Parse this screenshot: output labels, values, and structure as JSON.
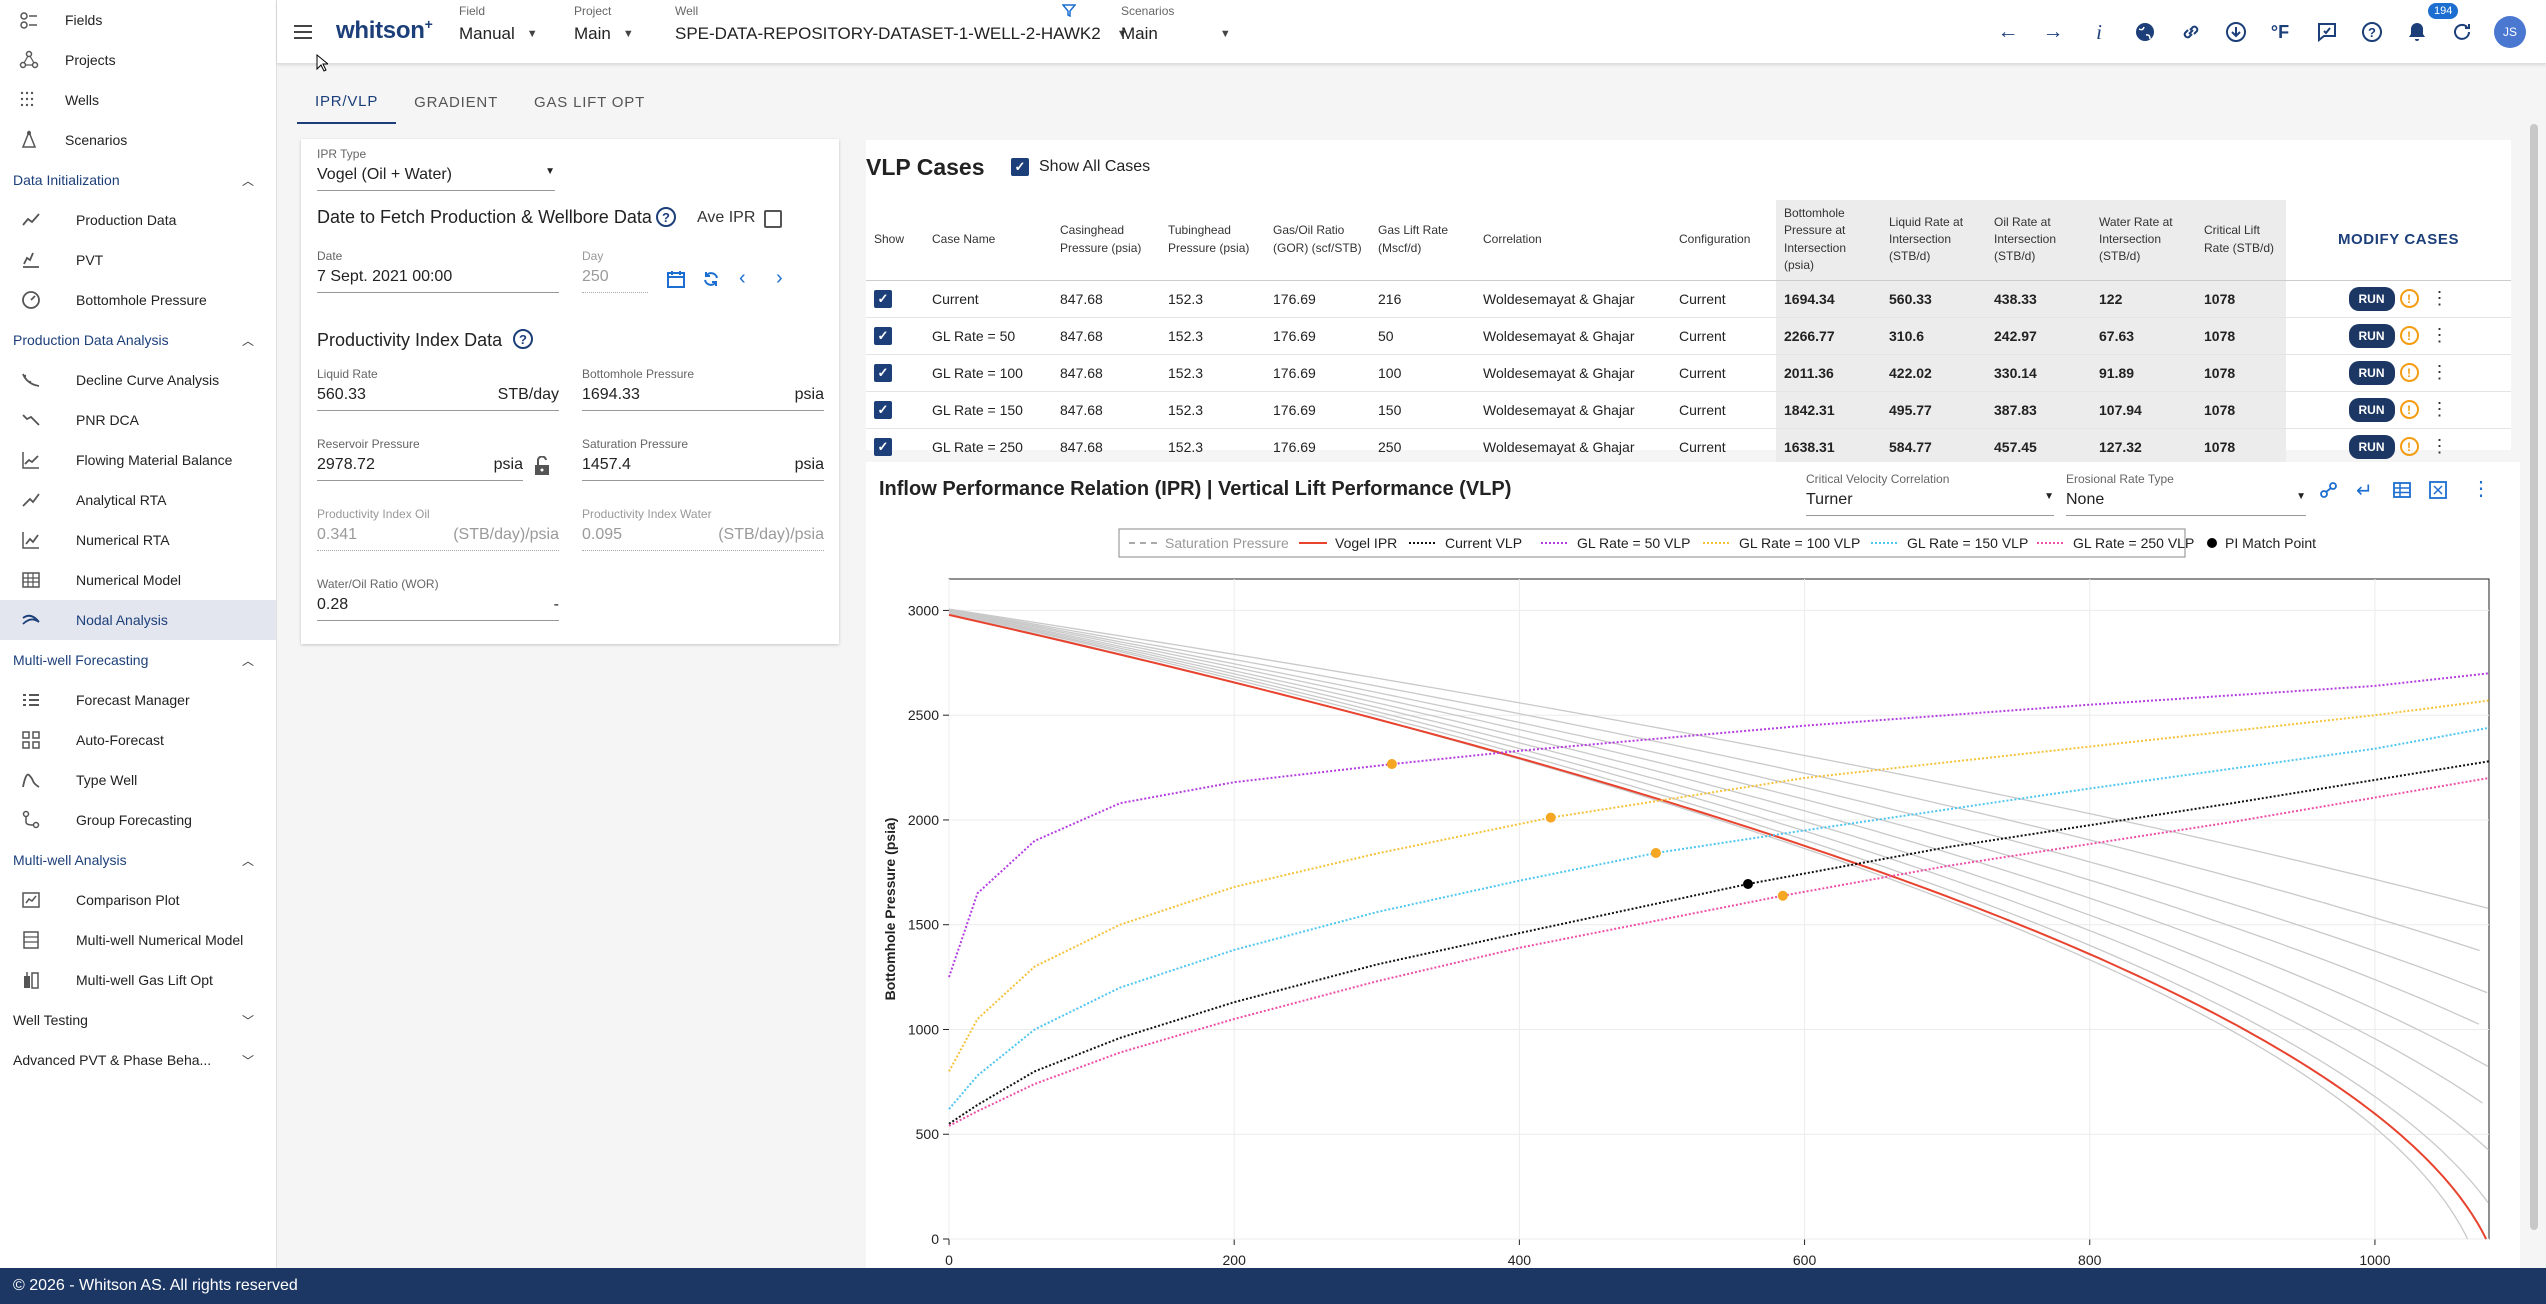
{
  "sidebar": {
    "top_items": [
      {
        "label": "Fields",
        "icon": "fields-icon"
      },
      {
        "label": "Projects",
        "icon": "projects-icon"
      },
      {
        "label": "Wells",
        "icon": "wells-icon"
      },
      {
        "label": "Scenarios",
        "icon": "scenarios-icon"
      }
    ],
    "sections": [
      {
        "label": "Data Initialization",
        "open": true,
        "items": [
          {
            "label": "Production Data",
            "icon": "production-data-icon"
          },
          {
            "label": "PVT",
            "icon": "pvt-icon"
          },
          {
            "label": "Bottomhole Pressure",
            "icon": "bottomhole-pressure-icon"
          }
        ]
      },
      {
        "label": "Production Data Analysis",
        "open": true,
        "items": [
          {
            "label": "Decline Curve Analysis",
            "icon": "decline-curve-icon"
          },
          {
            "label": "PNR DCA",
            "icon": "pnr-dca-icon"
          },
          {
            "label": "Flowing Material Balance",
            "icon": "flowing-material-balance-icon"
          },
          {
            "label": "Analytical RTA",
            "icon": "analytical-rta-icon"
          },
          {
            "label": "Numerical RTA",
            "icon": "numerical-rta-icon"
          },
          {
            "label": "Numerical Model",
            "icon": "numerical-model-icon"
          },
          {
            "label": "Nodal Analysis",
            "icon": "nodal-analysis-icon",
            "active": true
          }
        ]
      },
      {
        "label": "Multi-well Forecasting",
        "open": true,
        "items": [
          {
            "label": "Forecast Manager",
            "icon": "forecast-manager-icon"
          },
          {
            "label": "Auto-Forecast",
            "icon": "auto-forecast-icon"
          },
          {
            "label": "Type Well",
            "icon": "type-well-icon"
          },
          {
            "label": "Group Forecasting",
            "icon": "group-forecasting-icon"
          }
        ]
      },
      {
        "label": "Multi-well Analysis",
        "open": true,
        "items": [
          {
            "label": "Comparison Plot",
            "icon": "comparison-plot-icon"
          },
          {
            "label": "Multi-well Numerical Model",
            "icon": "multiwell-numerical-model-icon"
          },
          {
            "label": "Multi-well Gas Lift Opt",
            "icon": "multiwell-gas-lift-icon"
          }
        ]
      },
      {
        "label": "Well Testing",
        "open": false,
        "items": []
      },
      {
        "label": "Advanced PVT & Phase Beha...",
        "open": false,
        "items": []
      }
    ]
  },
  "topbar": {
    "logo": "whitson",
    "logo_sup": "+",
    "field": {
      "caption": "Field",
      "value": "Manual"
    },
    "project": {
      "caption": "Project",
      "value": "Main"
    },
    "well": {
      "caption": "Well",
      "value": "SPE-DATA-REPOSITORY-DATASET-1-WELL-2-HAWK2"
    },
    "scenarios": {
      "caption": "Scenarios",
      "value": "Main"
    },
    "notification_count": "194",
    "units_label": "°F",
    "avatar_initials": "JS"
  },
  "tabs": [
    "IPR/VLP",
    "GRADIENT",
    "GAS LIFT OPT"
  ],
  "ipr": {
    "type_caption": "IPR Type",
    "type_value": "Vogel (Oil + Water)",
    "date_section_title": "Date to Fetch Production & Wellbore Data",
    "ave_ipr_label": "Ave IPR",
    "date_caption": "Date",
    "date_value": "7 Sept. 2021 00:00",
    "day_caption": "Day",
    "day_value": "250",
    "pi_section_title": "Productivity Index Data",
    "liquid_rate": {
      "caption": "Liquid Rate",
      "value": "560.33",
      "unit": "STB/day"
    },
    "bhp": {
      "caption": "Bottomhole Pressure",
      "value": "1694.33",
      "unit": "psia"
    },
    "reservoir_pressure": {
      "caption": "Reservoir Pressure",
      "value": "2978.72",
      "unit": "psia"
    },
    "saturation_pressure": {
      "caption": "Saturation Pressure",
      "value": "1457.4",
      "unit": "psia"
    },
    "pi_oil": {
      "caption": "Productivity Index Oil",
      "value": "0.341",
      "unit": "(STB/day)/psia"
    },
    "pi_water": {
      "caption": "Productivity Index Water",
      "value": "0.095",
      "unit": "(STB/day)/psia"
    },
    "wor": {
      "caption": "Water/Oil Ratio (WOR)",
      "value": "0.28",
      "unit": "-"
    }
  },
  "vlp": {
    "title": "VLP Cases",
    "show_all_label": "Show All Cases",
    "modify_label": "MODIFY CASES",
    "run_label": "RUN",
    "columns": [
      "Show",
      "Case Name",
      "Casinghead Pressure (psia)",
      "Tubinghead Pressure (psia)",
      "Gas/Oil Ratio (GOR) (scf/STB)",
      "Gas Lift Rate (Mscf/d)",
      "Correlation",
      "Configuration",
      "Bottomhole Pressure at Intersection (psia)",
      "Liquid Rate at Intersection (STB/d)",
      "Oil Rate at Intersection (STB/d)",
      "Water Rate at Intersection (STB/d)",
      "Critical Lift Rate (STB/d)"
    ],
    "rows": [
      [
        "Current",
        "847.68",
        "152.3",
        "176.69",
        "216",
        "Woldesemayat & Ghajar",
        "Current",
        "1694.34",
        "560.33",
        "438.33",
        "122",
        "1078"
      ],
      [
        "GL Rate = 50",
        "847.68",
        "152.3",
        "176.69",
        "50",
        "Woldesemayat & Ghajar",
        "Current",
        "2266.77",
        "310.6",
        "242.97",
        "67.63",
        "1078"
      ],
      [
        "GL Rate = 100",
        "847.68",
        "152.3",
        "176.69",
        "100",
        "Woldesemayat & Ghajar",
        "Current",
        "2011.36",
        "422.02",
        "330.14",
        "91.89",
        "1078"
      ],
      [
        "GL Rate = 150",
        "847.68",
        "152.3",
        "176.69",
        "150",
        "Woldesemayat & Ghajar",
        "Current",
        "1842.31",
        "495.77",
        "387.83",
        "107.94",
        "1078"
      ],
      [
        "GL Rate = 250",
        "847.68",
        "152.3",
        "176.69",
        "250",
        "Woldesemayat & Ghajar",
        "Current",
        "1638.31",
        "584.77",
        "457.45",
        "127.32",
        "1078"
      ]
    ]
  },
  "chart_panel": {
    "title": "Inflow Performance Relation (IPR) | Vertical Lift Performance (VLP)",
    "critical_velocity": {
      "caption": "Critical Velocity Correlation",
      "value": "Turner"
    },
    "erosional_rate": {
      "caption": "Erosional Rate Type",
      "value": "None"
    }
  },
  "chart_data": {
    "type": "line",
    "ylabel": "Bottomhole Pressure (psia)",
    "xlabel": "",
    "xlim": [
      0,
      1080
    ],
    "ylim": [
      0,
      3150
    ],
    "xticks": [
      0,
      200,
      400,
      600,
      800,
      1000
    ],
    "yticks": [
      0,
      500,
      1000,
      1500,
      2000,
      2500,
      3000
    ],
    "grid": true,
    "legend_position": "top",
    "legend": [
      {
        "name": "Saturation Pressure",
        "color": "#aaaaaa",
        "style": "dash"
      },
      {
        "name": "Vogel IPR",
        "color": "#e8432e",
        "style": "solid"
      },
      {
        "name": "Current VLP",
        "color": "#111111",
        "style": "dot"
      },
      {
        "name": "GL Rate = 50 VLP",
        "color": "#b43de0",
        "style": "dot"
      },
      {
        "name": "GL Rate = 100 VLP",
        "color": "#f5c23b",
        "style": "dot"
      },
      {
        "name": "GL Rate = 150 VLP",
        "color": "#4fc6ef",
        "style": "dot"
      },
      {
        "name": "GL Rate = 250 VLP",
        "color": "#ec4fa8",
        "style": "dot"
      },
      {
        "name": "PI Match Point",
        "color": "#000000",
        "style": "marker"
      }
    ],
    "ipr": {
      "pr": 2978.72,
      "qmax": 1078,
      "color": "#e8432e"
    },
    "historical_ipr": {
      "color": "#c9c9c9",
      "curves": [
        {
          "pr": 2985,
          "qmax": 1065
        },
        {
          "pr": 2990,
          "qmax": 1095
        },
        {
          "pr": 2992,
          "qmax": 1130
        },
        {
          "pr": 2995,
          "qmax": 1170
        },
        {
          "pr": 2997,
          "qmax": 1220
        },
        {
          "pr": 3000,
          "qmax": 1280
        },
        {
          "pr": 3002,
          "qmax": 1350
        },
        {
          "pr": 3004,
          "qmax": 1450
        },
        {
          "pr": 3006,
          "qmax": 1600
        }
      ]
    },
    "series": [
      {
        "name": "GL Rate = 50 VLP",
        "color": "#b43de0",
        "x": [
          0,
          20,
          60,
          120,
          200,
          310.6,
          400,
          600,
          800,
          1000,
          1080
        ],
        "y": [
          1250,
          1650,
          1900,
          2080,
          2180,
          2266.77,
          2330,
          2450,
          2550,
          2640,
          2700
        ]
      },
      {
        "name": "GL Rate = 100 VLP",
        "color": "#f5c23b",
        "x": [
          0,
          20,
          60,
          120,
          200,
          300,
          422.02,
          600,
          800,
          1000,
          1080
        ],
        "y": [
          800,
          1050,
          1300,
          1500,
          1680,
          1840,
          2011.36,
          2200,
          2350,
          2500,
          2570
        ]
      },
      {
        "name": "GL Rate = 150 VLP",
        "color": "#4fc6ef",
        "x": [
          0,
          20,
          60,
          120,
          200,
          300,
          400,
          495.77,
          600,
          800,
          1000,
          1080
        ],
        "y": [
          620,
          780,
          1000,
          1200,
          1380,
          1560,
          1710,
          1842.31,
          1950,
          2150,
          2340,
          2440
        ]
      },
      {
        "name": "Current VLP",
        "color": "#111111",
        "x": [
          0,
          20,
          60,
          120,
          200,
          300,
          400,
          560.33,
          700,
          900,
          1080
        ],
        "y": [
          550,
          640,
          800,
          960,
          1130,
          1310,
          1460,
          1694.34,
          1870,
          2080,
          2280
        ]
      },
      {
        "name": "GL Rate = 250 VLP",
        "color": "#ec4fa8",
        "x": [
          0,
          20,
          60,
          120,
          200,
          300,
          400,
          584.77,
          700,
          900,
          1080
        ],
        "y": [
          540,
          610,
          740,
          890,
          1050,
          1230,
          1390,
          1638.31,
          1780,
          1990,
          2200
        ]
      }
    ],
    "points": [
      {
        "name": "GL Rate = 50",
        "x": 310.6,
        "y": 2266.77,
        "color": "#f5a623"
      },
      {
        "name": "GL Rate = 100",
        "x": 422.02,
        "y": 2011.36,
        "color": "#f5a623"
      },
      {
        "name": "GL Rate = 150",
        "x": 495.77,
        "y": 1842.31,
        "color": "#f5a623"
      },
      {
        "name": "GL Rate = 250",
        "x": 584.77,
        "y": 1638.31,
        "color": "#f5a623"
      },
      {
        "name": "PI Match Point",
        "x": 560.33,
        "y": 1694.34,
        "color": "#000000"
      }
    ]
  },
  "footer": "© 2026 - Whitson AS. All rights reserved"
}
